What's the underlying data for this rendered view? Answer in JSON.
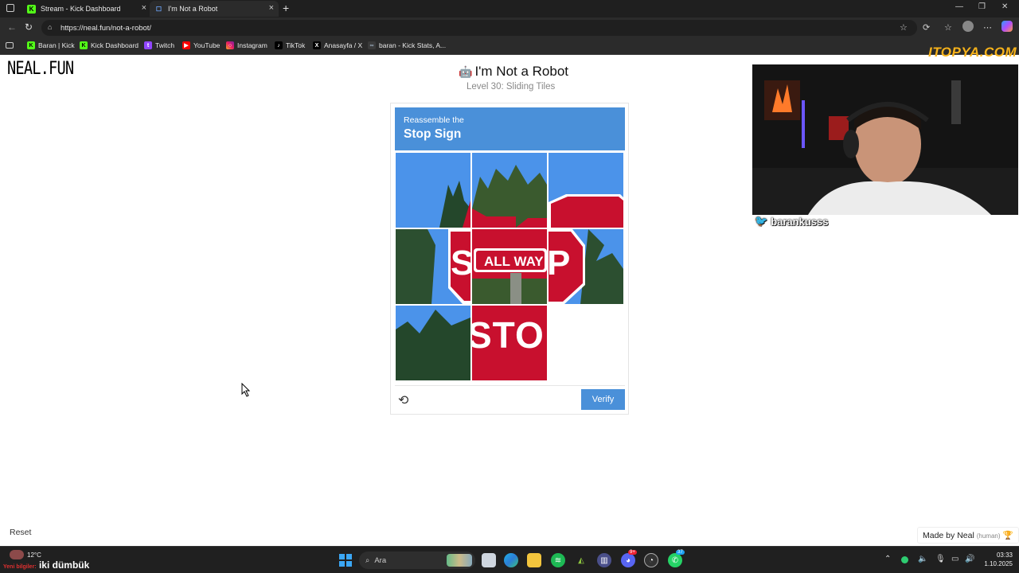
{
  "browser": {
    "tabs": [
      {
        "label": "Stream - Kick Dashboard",
        "active": false
      },
      {
        "label": "I'm Not a Robot",
        "active": true
      }
    ],
    "url": "https://neal.fun/not-a-robot/",
    "bookmarks": [
      {
        "label": "Baran | Kick",
        "icon": "kick-icon"
      },
      {
        "label": "Kick Dashboard",
        "icon": "kick-icon"
      },
      {
        "label": "Twitch",
        "icon": "twitch-icon"
      },
      {
        "label": "YouTube",
        "icon": "youtube-icon"
      },
      {
        "label": "Instagram",
        "icon": "instagram-icon"
      },
      {
        "label": "TikTok",
        "icon": "tiktok-icon"
      },
      {
        "label": "Anasayfa / X",
        "icon": "x-icon"
      },
      {
        "label": "baran - Kick Stats, A...",
        "icon": "stats-icon"
      }
    ]
  },
  "page": {
    "logo": "NEAL.FUN",
    "title": "I'm Not a Robot",
    "level": "Level 30: Sliding Tiles",
    "captcha": {
      "instruction": "Reassemble the",
      "target": "Stop Sign",
      "tile_text_allway": "ALL WAY",
      "tile_text_stop": "STO",
      "tile_text_s": "S",
      "tile_text_p": "P",
      "verify_label": "Verify"
    },
    "reset_label": "Reset",
    "made_by": "Made by Neal",
    "made_by_tag": "(human)"
  },
  "overlay": {
    "watermark": "ITOPYA.COM",
    "twitter_handle": "barankusss"
  },
  "taskbar": {
    "weather_temp": "12°C",
    "ticker_prefix": "Yeni bilgiler:",
    "ticker_text": "iki dümbük",
    "search_placeholder": "Ara",
    "time": "03:33",
    "date": "1.10.2025",
    "badge_1": "9+",
    "badge_2": "37"
  },
  "colors": {
    "accent": "#4a90d9",
    "stop_red": "#c8102e",
    "chrome_dark": "#2b2b2b"
  }
}
